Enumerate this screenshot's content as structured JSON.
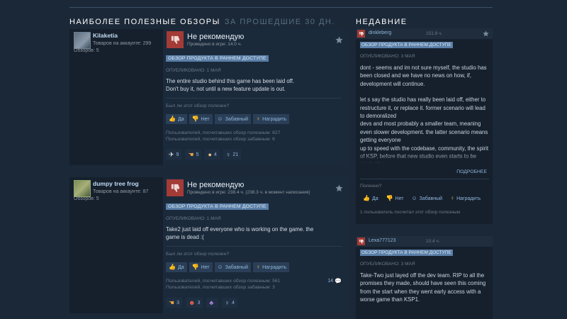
{
  "section_left": {
    "title": "НАИБОЛЕЕ ПОЛЕЗНЫЕ ОБЗОРЫ",
    "subtitle": "ЗА ПРОШЕДШИЕ 30 ДН."
  },
  "section_right": {
    "title": "НЕДАВНИЕ"
  },
  "colors": {
    "background": "#1b2838",
    "negative": "#a33b36",
    "badge": "#5a7fa8",
    "link": "#8fb5d9"
  },
  "reviews": [
    {
      "user": {
        "name": "Kilaketia",
        "products": "Товаров на аккаунте: 299",
        "reviews": "Обзоров: 5"
      },
      "verdict": "Не рекомендую",
      "hours": "Проведено в игре: 14.0 ч.",
      "badge": "ОБЗОР ПРОДУКТА В РАННЕМ ДОСТУПЕ",
      "posted": "ОПУБЛИКОВАНО: 1 МАЯ",
      "body_line1": "The entire studio behind this game has been laid off.",
      "body_line2": "Don't buy it, not until a new feature update is out.",
      "helpful_q": "Был ли этот обзор полезен?",
      "btn_yes": "Да",
      "btn_no": "Нет",
      "btn_funny": "Забавный",
      "btn_award": "Наградить",
      "stat_helpful": "Пользователей, посчитавших обзор полезным: 827",
      "stat_funny": "Пользователей, посчитавших обзор забавным: 6",
      "awards": [
        {
          "icon": "winged-award-icon",
          "count": "9"
        },
        {
          "icon": "hand-award-icon",
          "count": "5"
        },
        {
          "icon": "cookie-award-icon",
          "count": "4"
        },
        {
          "icon": "ribbon-award-icon",
          "count": "21"
        }
      ]
    },
    {
      "user": {
        "name": "dumpy tree frog",
        "products": "Товаров на аккаунте: 87",
        "reviews": "Обзоров: 5"
      },
      "verdict": "Не рекомендую",
      "hours": "Проведено в игре: 238.4 ч. (238.3 ч. в момент написания)",
      "badge": "ОБЗОР ПРОДУКТА В РАННЕМ ДОСТУПЕ",
      "posted": "ОПУБЛИКОВАНО: 1 МАЯ",
      "body_line1": "Take2 just laid off everyone who is working on the game. the",
      "body_line2": "game is dead :(",
      "helpful_q": "Был ли этот обзор полезен?",
      "btn_yes": "Да",
      "btn_no": "Нет",
      "btn_funny": "Забавный",
      "btn_award": "Наградить",
      "stat_helpful": "Пользователей, посчитавших обзор полезным: 561",
      "stat_funny": "Пользователей, посчитавших обзор забавным: 3",
      "comments": "14",
      "awards": [
        {
          "icon": "hand-award-icon",
          "count": "3"
        },
        {
          "icon": "clown-award-icon",
          "count": "3"
        },
        {
          "icon": "purple-award-icon",
          "count": ""
        },
        {
          "icon": "ribbon-award-icon",
          "count": "4"
        }
      ]
    }
  ],
  "recent": [
    {
      "name": "dinkleberg",
      "hours": "151.8 ч.",
      "badge": "ОБЗОР ПРОДУКТА В РАННЕМ ДОСТУПЕ",
      "posted": "ОПУБЛИКОВАНО: 3 МАЯ",
      "p1": "dont - seems and im not sure myself, the studio has been closed and we have no news on how, if, development will continue.",
      "p2": "let s say the studio has really been laid off, either to restructure it, or replace it. former scenario will lead to demoralized",
      "p3": "devs and most probably a smaller team, meaning even slower development. the latter scenario means getting everyone",
      "p4": "up to speed with the codebase, community, the spirit of KSP, before that new studio even starts to be productive.",
      "more": "ПОДРОБНЕЕ",
      "helpful_q": "Полезно?",
      "btn_yes": "Да",
      "btn_no": "Нет",
      "btn_funny": "Забавный",
      "btn_award": "Наградить",
      "stat": "1 пользователь посчитал этот обзор полезным"
    },
    {
      "name": "Lexa777123",
      "hours": "10.4 ч.",
      "badge": "ОБЗОР ПРОДУКТА В РАННЕМ ДОСТУПЕ",
      "posted": "ОПУБЛИКОВАНО: 3 МАЯ",
      "p1": "Take-Two just layed off the dev team. RIP to all the promises they made, should have seen this coming from the start when they went early access with a worse game than KSP1."
    }
  ]
}
